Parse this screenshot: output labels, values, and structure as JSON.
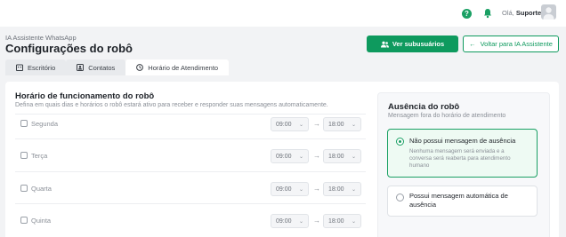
{
  "topbar": {
    "help_icon": "question-circle-icon",
    "bell_icon": "bell-icon",
    "greeting_prefix": "Olá,",
    "user_name": "Suporte"
  },
  "header": {
    "breadcrumb": "IA Assistente WhatsApp",
    "title": "Configurações do robô",
    "subusers_button": "Ver subusuários",
    "back_button": "Voltar para IA Assistente"
  },
  "tabs": [
    {
      "label": "Escritório",
      "icon": "building-icon",
      "active": false
    },
    {
      "label": "Contatos",
      "icon": "contacts-icon",
      "active": false
    },
    {
      "label": "Horário de Atendimento",
      "icon": "clock-icon",
      "active": true
    }
  ],
  "schedule": {
    "title": "Horário de funcionamento do robô",
    "description": "Defina em quais dias e horários o robô estará ativo para receber e responder suas mensagens automaticamente.",
    "days": [
      {
        "label": "Segunda",
        "start": "09:00",
        "end": "18:00"
      },
      {
        "label": "Terça",
        "start": "09:00",
        "end": "18:00"
      },
      {
        "label": "Quarta",
        "start": "09:00",
        "end": "18:00"
      },
      {
        "label": "Quinta",
        "start": "09:00",
        "end": "18:00"
      }
    ],
    "arrow": "→"
  },
  "absence": {
    "title": "Ausência do robô",
    "description": "Mensagem fora do horário de atendimento",
    "option_none_label": "Não possui mensagem de ausência",
    "option_none_sub": "Nenhuma mensagem será enviada e a conversa será reaberta para atendimento humano",
    "option_auto_label": "Possui mensagem automática de ausência"
  },
  "colors": {
    "accent": "#0e9a5e",
    "background": "#f2f3f5"
  }
}
